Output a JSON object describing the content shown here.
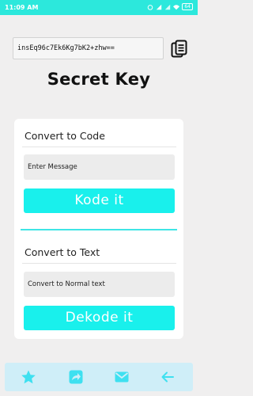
{
  "status_bar": {
    "time": "11:09 AM",
    "battery": "64"
  },
  "secret_key": {
    "value": "insEq96c7Ek6Kg7bK2+zhw=="
  },
  "page_title": "Secret Key",
  "encode": {
    "title": "Convert to Code",
    "input_placeholder": "Enter Message",
    "button_label": "Kode it"
  },
  "decode": {
    "title": "Convert to Text",
    "input_placeholder": "Convert to Normal text",
    "button_label": "Dekode it"
  },
  "bottom_nav": [
    {
      "icon": "star-icon"
    },
    {
      "icon": "share-icon"
    },
    {
      "icon": "mail-icon"
    },
    {
      "icon": "arrow-left-icon"
    }
  ],
  "colors": {
    "accent": "#19f0ec",
    "status_bar": "#2ce8dc",
    "bottom_bar": "#cfeef8",
    "nav_icon": "#3ee0f0"
  }
}
